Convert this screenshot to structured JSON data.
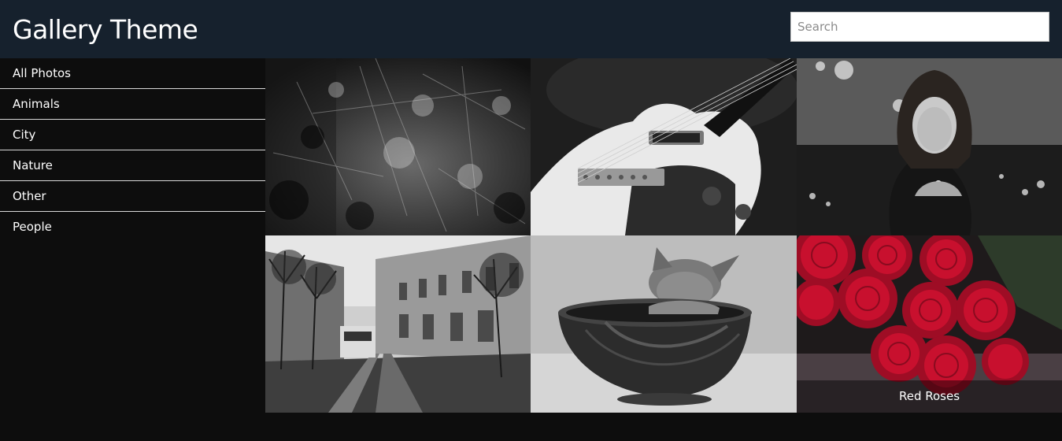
{
  "header": {
    "title": "Gallery Theme",
    "search_placeholder": "Search"
  },
  "sidebar": {
    "items": [
      {
        "label": "All Photos"
      },
      {
        "label": "Animals"
      },
      {
        "label": "City"
      },
      {
        "label": "Nature"
      },
      {
        "label": "Other"
      },
      {
        "label": "People"
      }
    ]
  },
  "gallery": {
    "photos": [
      {
        "subject": "grunge texture",
        "caption": ""
      },
      {
        "subject": "electric guitar",
        "caption": ""
      },
      {
        "subject": "woman with lights",
        "caption": ""
      },
      {
        "subject": "city street with tram",
        "caption": ""
      },
      {
        "subject": "kitten in bowl",
        "caption": ""
      },
      {
        "subject": "red roses",
        "caption": "Red Roses"
      }
    ]
  },
  "colors": {
    "header_bg": "#16212d",
    "page_bg": "#0d0d0d",
    "rose_red": "#c8102e"
  }
}
